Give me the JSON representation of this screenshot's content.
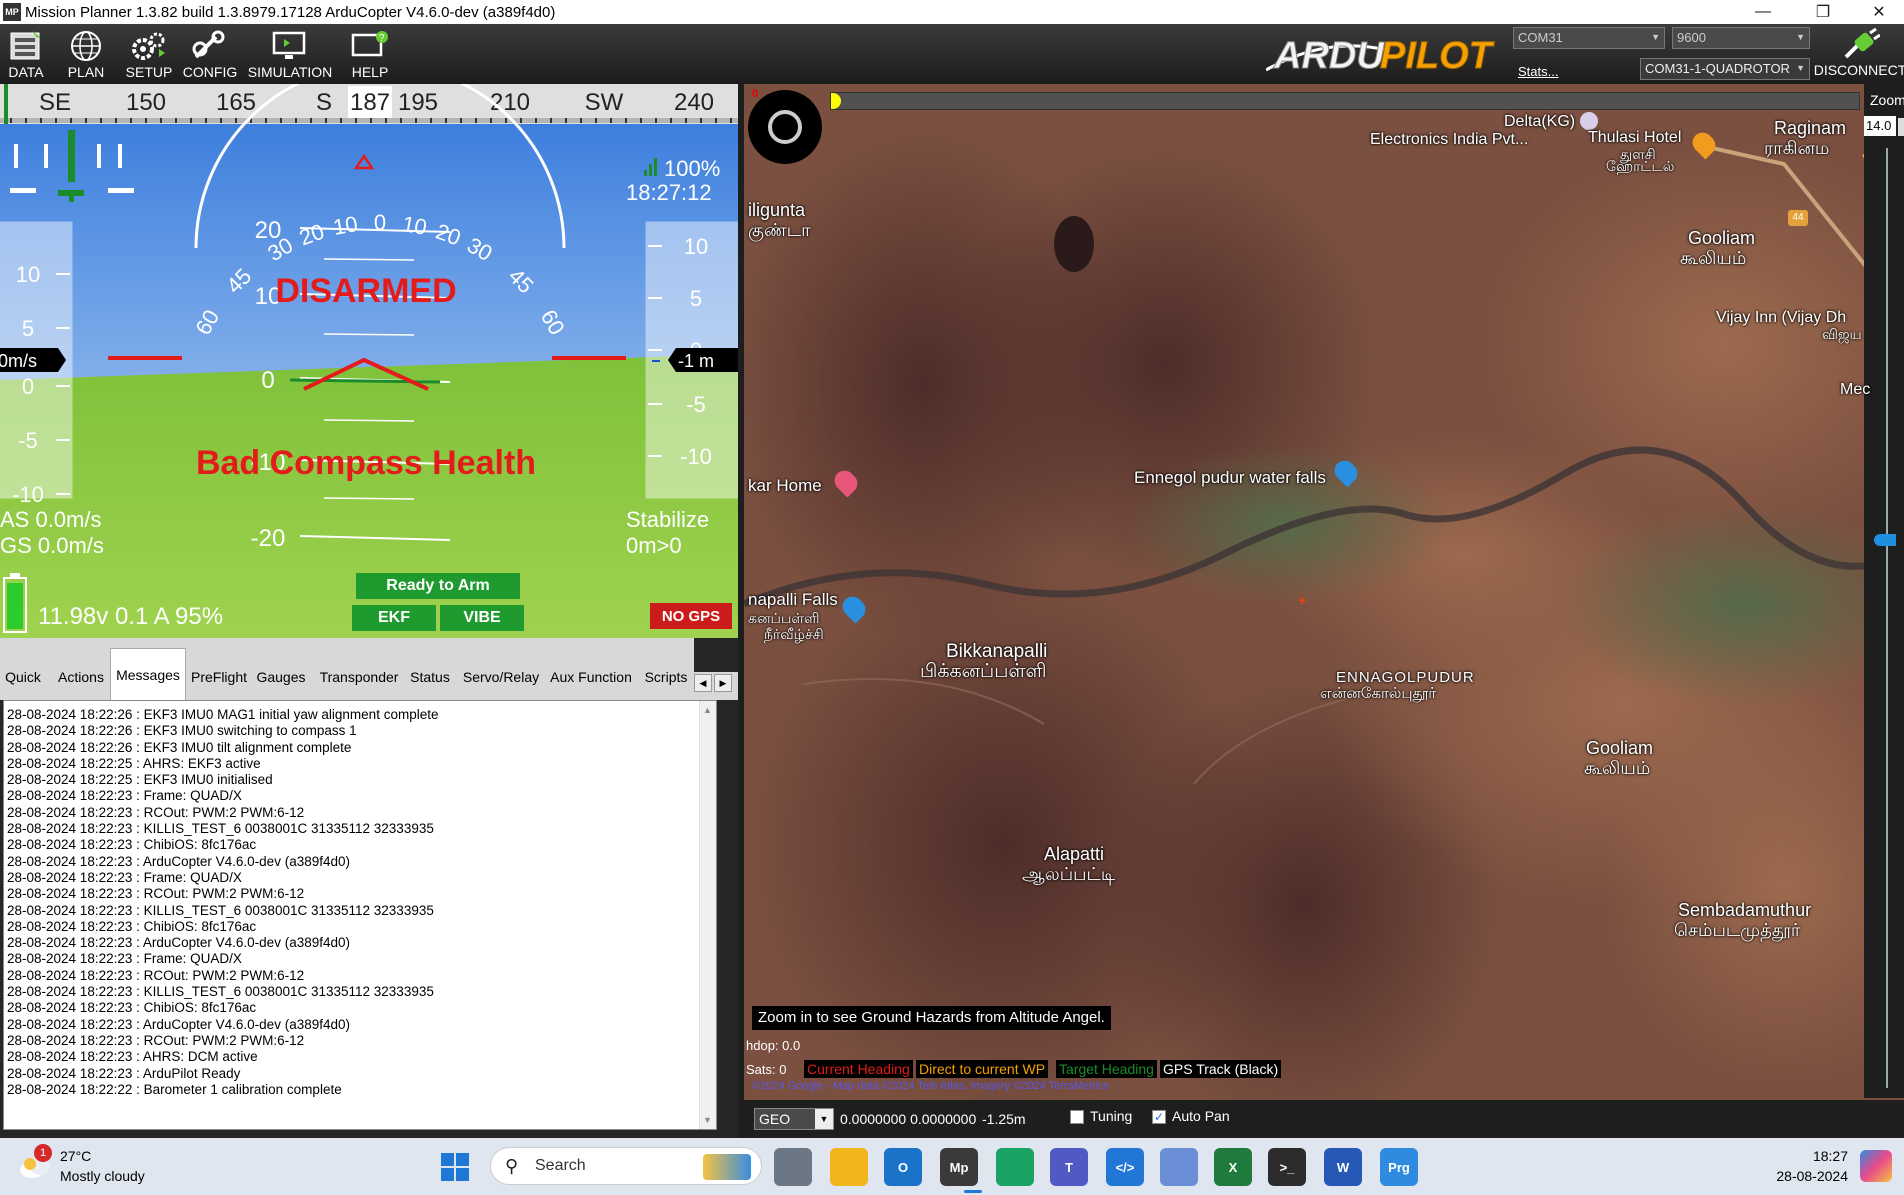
{
  "window": {
    "title": "Mission Planner 1.3.82 build 1.3.8979.17128 ArduCopter V4.6.0-dev (a389f4d0)",
    "icon_label": "MP"
  },
  "toolbar": {
    "buttons": [
      "DATA",
      "PLAN",
      "SETUP",
      "CONFIG",
      "SIMULATION",
      "HELP"
    ],
    "logo_text": "ARDUPILOT",
    "port": "COM31",
    "baud": "9600",
    "link": "COM31-1-QUADROTOR",
    "stats": "Stats...",
    "disconnect": "DISCONNECT"
  },
  "hud": {
    "compass": [
      {
        "label": "SE"
      },
      {
        "label": "150"
      },
      {
        "label": "165"
      },
      {
        "label": "S"
      },
      {
        "label": "187"
      },
      {
        "label": "195"
      },
      {
        "label": "210"
      },
      {
        "label": "SW"
      },
      {
        "label": "240"
      }
    ],
    "roll_ticks": [
      "60",
      "45",
      "30",
      "20",
      "10",
      "0",
      "10",
      "20",
      "30",
      "45",
      "60"
    ],
    "pitch_ticks": [
      "20",
      "10",
      "0",
      "-10",
      "-20"
    ],
    "speed_ticks": [
      "10",
      "5",
      "0",
      "-5",
      "-10"
    ],
    "alt_ticks": [
      "10",
      "5",
      "0",
      "-5",
      "-10"
    ],
    "speed_readout": "0m/s",
    "alt_readout": "-1 m",
    "signal": "100%",
    "time": "18:27:12",
    "status_disarmed": "DISARMED",
    "status_warning": "Bad Compass Health",
    "airspeed": "AS 0.0m/s",
    "groundspeed": "GS 0.0m/s",
    "mode": "Stabilize",
    "distance": "0m>0",
    "battery": "11.98v 0.1 A 95%",
    "battery_level": 0.95,
    "ready": "Ready to Arm",
    "ekf": "EKF",
    "vibe": "VIBE",
    "gps": "NO GPS",
    "colors": {
      "sky": "#5a96e6",
      "ground": "#8cc63f",
      "warning": "#e31b1b",
      "ok_green": "#1f9a2f"
    }
  },
  "tabs": [
    "Quick",
    "Actions",
    "Messages",
    "PreFlight",
    "Gauges",
    "Transponder",
    "Status",
    "Servo/Relay",
    "Aux Function",
    "Scripts"
  ],
  "active_tab": "Messages",
  "messages": [
    "28-08-2024 18:22:26 : EKF3 IMU0 MAG1 initial yaw alignment complete",
    "28-08-2024 18:22:26 : EKF3 IMU0 switching to compass 1",
    "28-08-2024 18:22:26 : EKF3 IMU0 tilt alignment complete",
    "28-08-2024 18:22:25 : AHRS: EKF3 active",
    "28-08-2024 18:22:25 : EKF3 IMU0 initialised",
    "28-08-2024 18:22:23 : Frame: QUAD/X",
    "28-08-2024 18:22:23 : RCOut: PWM:2 PWM:6-12",
    "28-08-2024 18:22:23 : KILLIS_TEST_6 0038001C 31335112 32333935",
    "28-08-2024 18:22:23 : ChibiOS: 8fc176ac",
    "28-08-2024 18:22:23 : ArduCopter V4.6.0-dev (a389f4d0)",
    "28-08-2024 18:22:23 : Frame: QUAD/X",
    "28-08-2024 18:22:23 : RCOut: PWM:2 PWM:6-12",
    "28-08-2024 18:22:23 : KILLIS_TEST_6 0038001C 31335112 32333935",
    "28-08-2024 18:22:23 : ChibiOS: 8fc176ac",
    "28-08-2024 18:22:23 : ArduCopter V4.6.0-dev (a389f4d0)",
    "28-08-2024 18:22:23 : Frame: QUAD/X",
    "28-08-2024 18:22:23 : RCOut: PWM:2 PWM:6-12",
    "28-08-2024 18:22:23 : KILLIS_TEST_6 0038001C 31335112 32333935",
    "28-08-2024 18:22:23 : ChibiOS: 8fc176ac",
    "28-08-2024 18:22:23 : ArduCopter V4.6.0-dev (a389f4d0)",
    "28-08-2024 18:22:23 : RCOut: PWM:2 PWM:6-12",
    "28-08-2024 18:22:23 : AHRS: DCM active",
    "28-08-2024 18:22:23 : ArduPilot Ready",
    "28-08-2024 18:22:22 : Barometer 1 calibration complete"
  ],
  "map": {
    "zoom_label": "Zoom",
    "zoom_value": "14.0",
    "places": [
      {
        "text": "Delta(KG)"
      },
      {
        "text": "Electronics India Pvt..."
      },
      {
        "text": "Thulasi Hotel"
      },
      {
        "text": "துளசி"
      },
      {
        "text": "ஹோட்டல்"
      },
      {
        "text": "Raginam"
      },
      {
        "text": "ராகினம"
      },
      {
        "text": "iligunta"
      },
      {
        "text": "குண்டா"
      },
      {
        "text": "Gooliam"
      },
      {
        "text": "கூலியம்"
      },
      {
        "text": "Vijay Inn (Vijay Dh"
      },
      {
        "text": "விஜய"
      },
      {
        "text": "Mec"
      },
      {
        "text": "kar Home"
      },
      {
        "text": "Ennegol pudur water falls"
      },
      {
        "text": "napalli Falls"
      },
      {
        "text": "கனப்பள்ளி"
      },
      {
        "text": "நீர்வீழ்ச்சி"
      },
      {
        "text": "Bikkanapalli"
      },
      {
        "text": "பிக்கனப்பள்ளி"
      },
      {
        "text": "ENNAGOLPUDUR"
      },
      {
        "text": "என்னகோல்புதூர்"
      },
      {
        "text": "Gooliam"
      },
      {
        "text": "கூலியம்"
      },
      {
        "text": "Alapatti"
      },
      {
        "text": "ஆலப்பட்டி"
      },
      {
        "text": "Sembadamuthur"
      },
      {
        "text": "செம்படமுத்தூர்"
      }
    ],
    "road_badge": "44",
    "altitude_angel_msg": "Zoom in to see Ground Hazards from Altitude Angel.",
    "hdop": "hdop: 0.0",
    "sats": "Sats: 0",
    "legend": {
      "current_heading": "Current Heading",
      "direct_wp": "Direct to current WP",
      "target_heading": "Target Heading",
      "gps_track": "GPS Track (Black)"
    },
    "attribution": "©2024 Google - Map data ©2024 Tele Atlas, Imagery ©2024 TerraMetrics",
    "coord_type": "GEO",
    "coords": "0.0000000 0.0000000",
    "alt": "-1.25m",
    "tuning": "Tuning",
    "autopan": "Auto Pan",
    "autopan_checked": true,
    "tuning_checked": false
  },
  "taskbar": {
    "weather_temp": "27°C",
    "weather_desc": "Mostly cloudy",
    "weather_badge": "1",
    "search": "Search",
    "time": "18:27",
    "date": "28-08-2024"
  }
}
